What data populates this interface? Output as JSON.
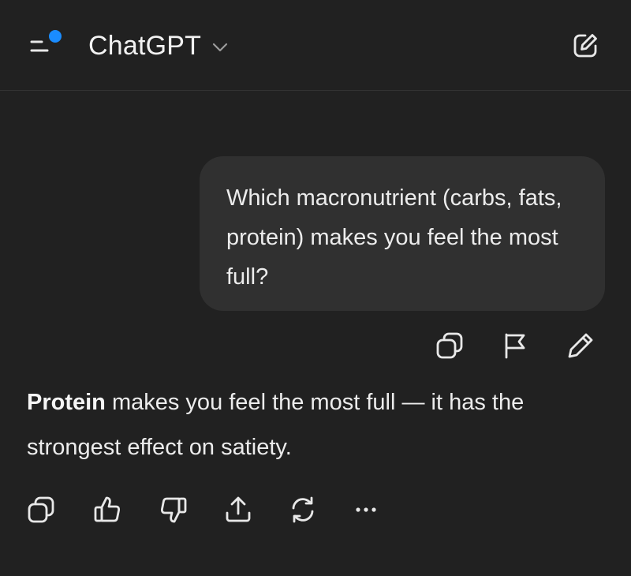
{
  "header": {
    "model_name": "ChatGPT",
    "menu_icon": "sidebar-menu-icon",
    "chevron_icon": "chevron-down-icon",
    "new_chat_icon": "new-chat-icon",
    "notification_color": "#1a8cff"
  },
  "conversation": {
    "user_message": "Which macronutrient (carbs, fats, protein) makes you feel the most full?",
    "user_actions": [
      "copy-icon",
      "flag-icon",
      "edit-icon"
    ],
    "assistant_message": {
      "bold_lead": "Protein",
      "text": " makes you feel the most full — it has the strongest effect on satiety."
    },
    "assistant_actions": [
      "copy-icon",
      "thumbs-up-icon",
      "thumbs-down-icon",
      "share-icon",
      "regenerate-icon",
      "more-icon"
    ]
  },
  "colors": {
    "background": "#212121",
    "bubble": "#303030",
    "text": "#ececec"
  }
}
